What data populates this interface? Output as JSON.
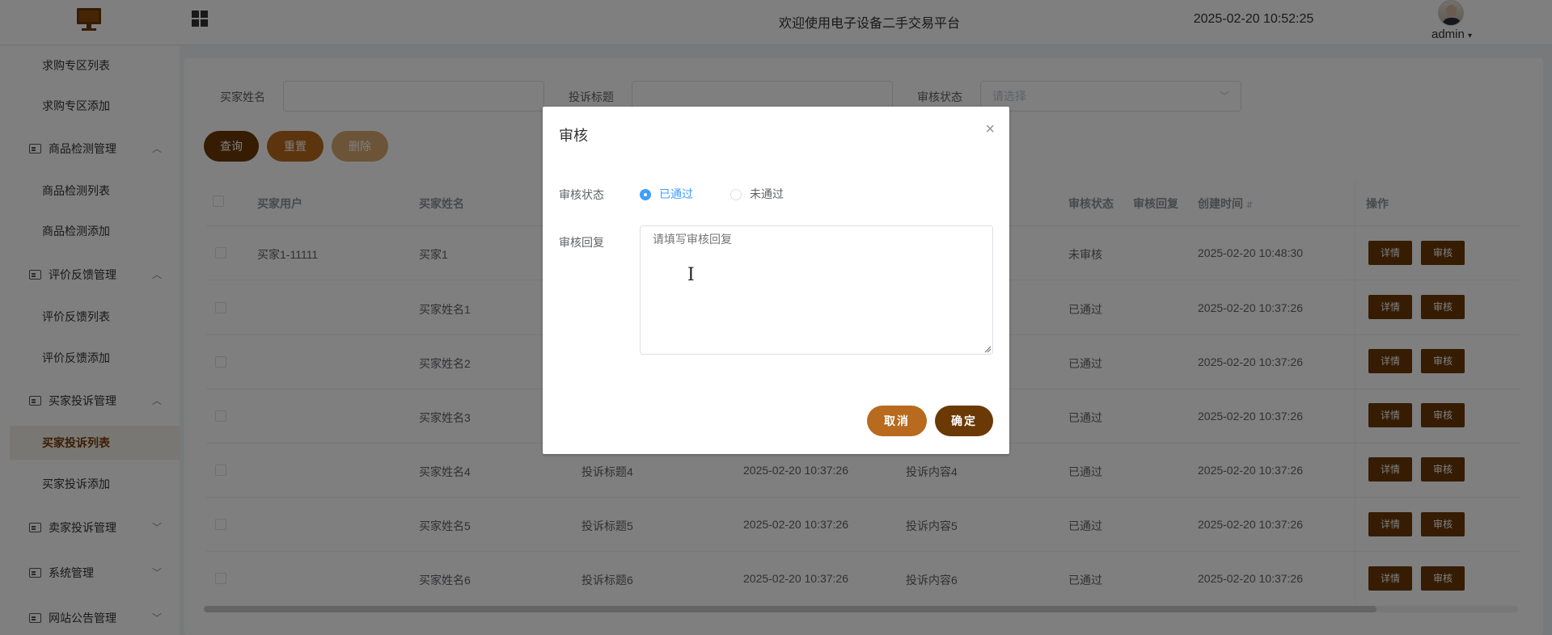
{
  "header": {
    "title": "欢迎使用电子设备二手交易平台",
    "datetime": "2025-02-20 10:52:25",
    "user": "admin"
  },
  "sidebar": {
    "items": [
      {
        "type": "sub",
        "label": "求购专区列表"
      },
      {
        "type": "sub",
        "label": "求购专区添加"
      },
      {
        "type": "group",
        "label": "商品检测管理",
        "expanded": true
      },
      {
        "type": "sub",
        "label": "商品检测列表"
      },
      {
        "type": "sub",
        "label": "商品检测添加"
      },
      {
        "type": "group",
        "label": "评价反馈管理",
        "expanded": true
      },
      {
        "type": "sub",
        "label": "评价反馈列表"
      },
      {
        "type": "sub",
        "label": "评价反馈添加"
      },
      {
        "type": "group",
        "label": "买家投诉管理",
        "expanded": true
      },
      {
        "type": "sub",
        "label": "买家投诉列表",
        "active": true
      },
      {
        "type": "sub",
        "label": "买家投诉添加"
      },
      {
        "type": "group",
        "label": "卖家投诉管理",
        "expanded": false
      },
      {
        "type": "group",
        "label": "系统管理",
        "expanded": false
      },
      {
        "type": "group",
        "label": "网站公告管理",
        "expanded": false
      }
    ]
  },
  "filters": {
    "buyer_name_label": "买家姓名",
    "title_label": "投诉标题",
    "status_label": "审核状态",
    "status_placeholder": "请选择"
  },
  "buttons": {
    "query": "查询",
    "reset": "重置",
    "delete": "删除"
  },
  "table": {
    "headers": {
      "user": "买家用户",
      "name": "买家姓名",
      "status": "审核状态",
      "reply": "审核回复",
      "created": "创建时间",
      "actions": "操作"
    },
    "rows": [
      {
        "user": "买家1-11111",
        "name": "买家1",
        "title": "",
        "time": "",
        "content": "",
        "status": "未审核",
        "created": "2025-02-20 10:48:30"
      },
      {
        "user": "",
        "name": "买家姓名1",
        "title": "",
        "time": "",
        "content": "",
        "status": "已通过",
        "created": "2025-02-20 10:37:26"
      },
      {
        "user": "",
        "name": "买家姓名2",
        "title": "",
        "time": "",
        "content": "",
        "status": "已通过",
        "created": "2025-02-20 10:37:26"
      },
      {
        "user": "",
        "name": "买家姓名3",
        "title": "",
        "time": "",
        "content": "",
        "status": "已通过",
        "created": "2025-02-20 10:37:26"
      },
      {
        "user": "",
        "name": "买家姓名4",
        "title": "投诉标题4",
        "time": "2025-02-20 10:37:26",
        "content": "投诉内容4",
        "status": "已通过",
        "created": "2025-02-20 10:37:26"
      },
      {
        "user": "",
        "name": "买家姓名5",
        "title": "投诉标题5",
        "time": "2025-02-20 10:37:26",
        "content": "投诉内容5",
        "status": "已通过",
        "created": "2025-02-20 10:37:26"
      },
      {
        "user": "",
        "name": "买家姓名6",
        "title": "投诉标题6",
        "time": "2025-02-20 10:37:26",
        "content": "投诉内容6",
        "status": "已通过",
        "created": "2025-02-20 10:37:26"
      }
    ],
    "detail_label": "详情",
    "audit_label": "审核"
  },
  "dialog": {
    "title": "审核",
    "status_label": "审核状态",
    "options": [
      "已通过",
      "未通过"
    ],
    "selected": "已通过",
    "reply_label": "审核回复",
    "reply_placeholder": "请填写审核回复",
    "cancel": "取消",
    "confirm": "确定"
  },
  "colors": {
    "primary": "#6b3906",
    "secondary": "#b86a1e",
    "disabled": "#d9a871",
    "radio_checked": "#409eff"
  }
}
